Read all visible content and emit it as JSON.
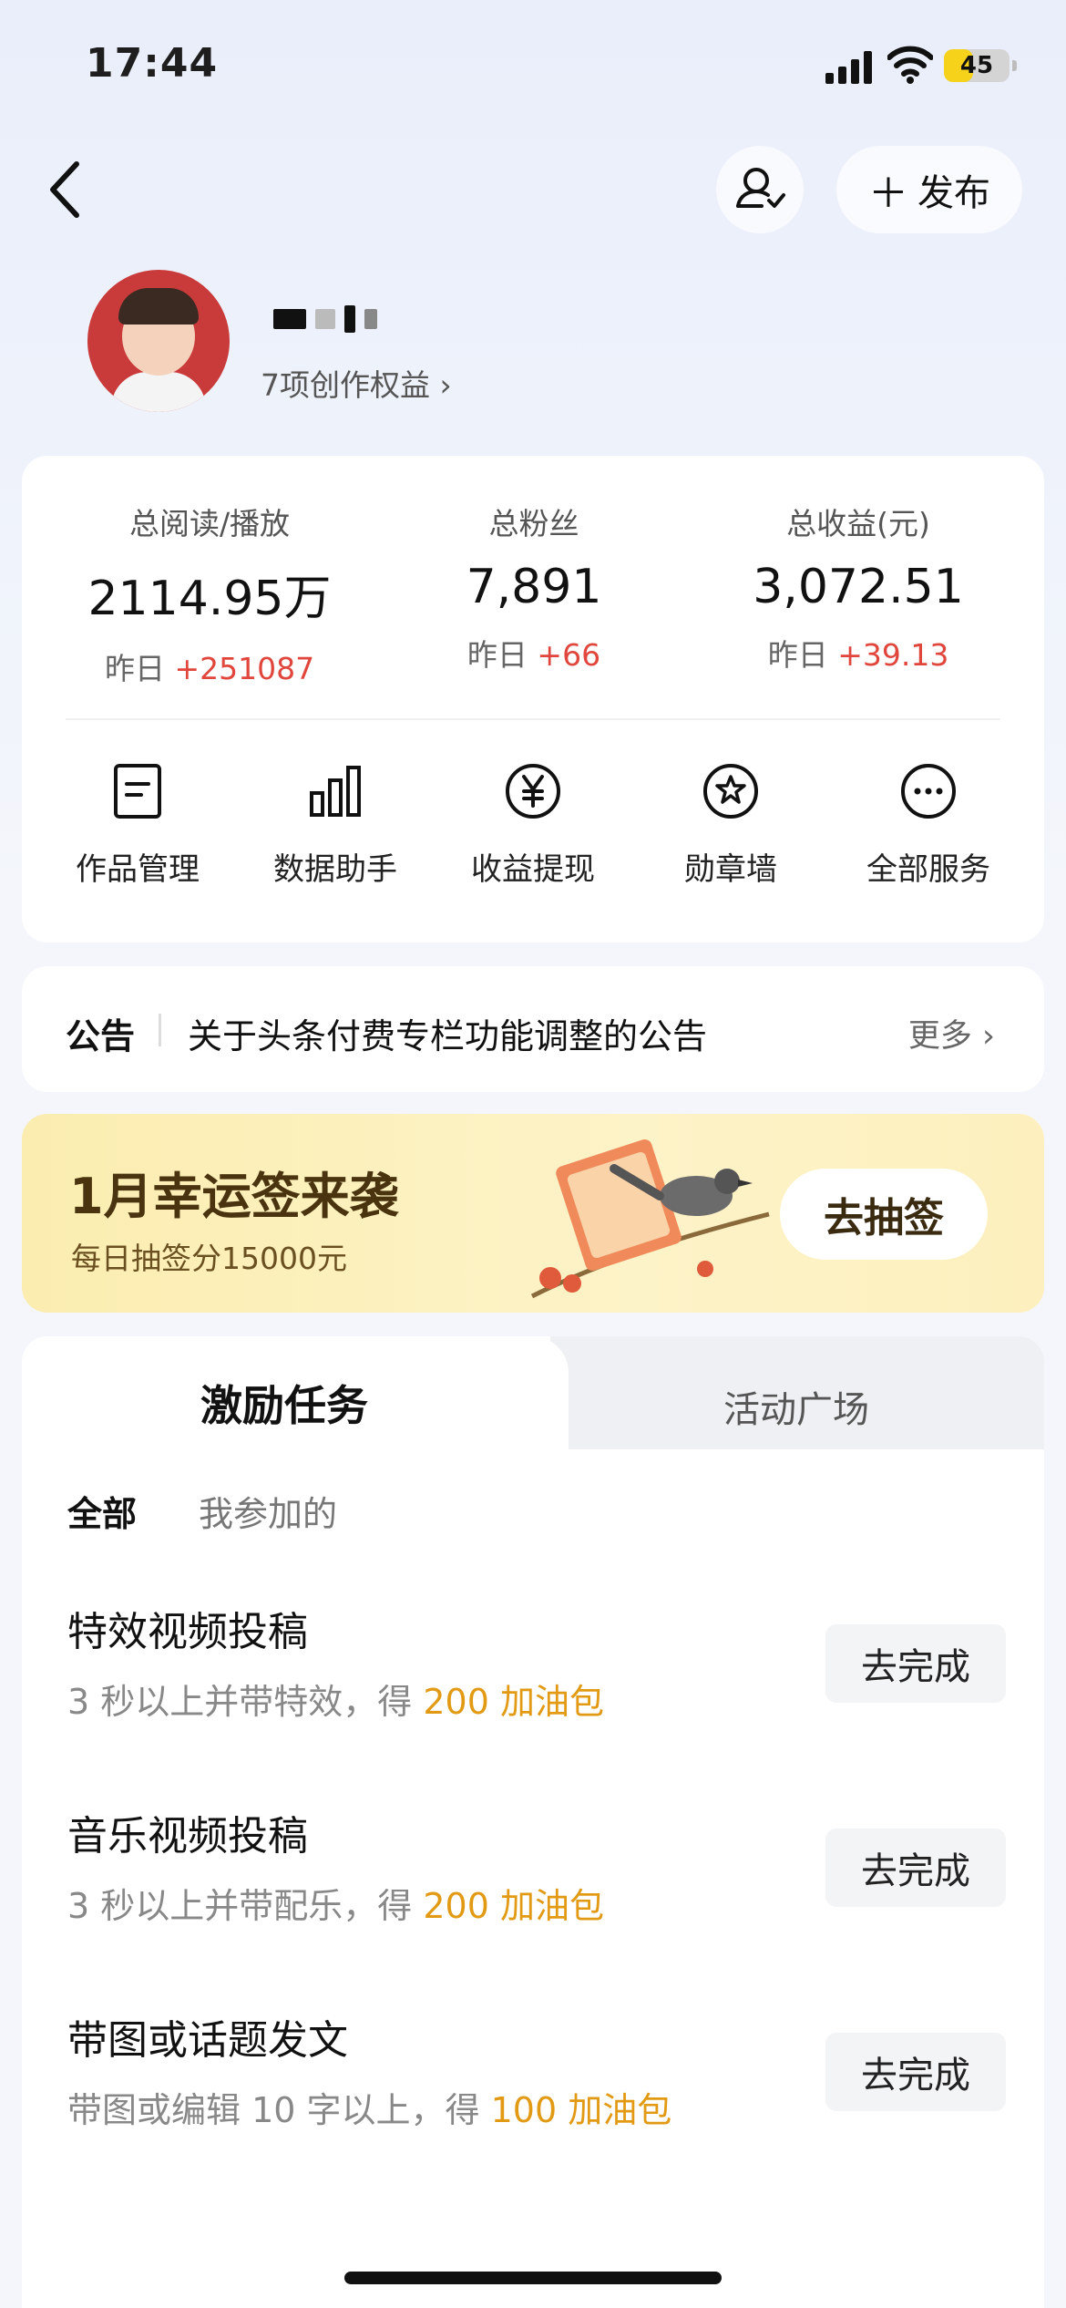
{
  "status_bar": {
    "time": "17:44",
    "battery": "45",
    "battery_level": 0.45
  },
  "header": {
    "publish_label": "发布",
    "icons": [
      "back-icon",
      "user-follow-icon",
      "plus-icon"
    ]
  },
  "profile": {
    "rights_label": "7项创作权益 ›"
  },
  "stats": [
    {
      "label": "总阅读/播放",
      "value": "2114.95万",
      "yday_prefix": "昨日 ",
      "yday_value": "+251087"
    },
    {
      "label": "总粉丝",
      "value": "7,891",
      "yday_prefix": "昨日 ",
      "yday_value": "+66"
    },
    {
      "label": "总收益(元)",
      "value": "3,072.51",
      "yday_prefix": "昨日 ",
      "yday_value": "+39.13"
    }
  ],
  "services": [
    {
      "label": "作品管理",
      "icon": "document-icon"
    },
    {
      "label": "数据助手",
      "icon": "bar-chart-icon"
    },
    {
      "label": "收益提现",
      "icon": "yen-icon"
    },
    {
      "label": "勋章墙",
      "icon": "badge-icon"
    },
    {
      "label": "全部服务",
      "icon": "more-icon"
    }
  ],
  "notice": {
    "tag": "公告",
    "text": "关于头条付费专栏功能调整的公告",
    "more": "更多 ›"
  },
  "banner": {
    "title": "1月幸运签来袭",
    "subtitle": "每日抽签分15000元",
    "button": "去抽签"
  },
  "tasks": {
    "tab_active": "激励任务",
    "tab_inactive": "活动广场",
    "filter_all": "全部",
    "filter_mine": "我参加的",
    "items": [
      {
        "title": "特效视频投稿",
        "desc": "3 秒以上并带特效，得 ",
        "reward": "200 加油包",
        "button": "去完成"
      },
      {
        "title": "音乐视频投稿",
        "desc": "3 秒以上并带配乐，得 ",
        "reward": "200 加油包",
        "button": "去完成"
      },
      {
        "title": "带图或话题发文",
        "desc": "带图或编辑 10 字以上，得 ",
        "reward": "100 加油包",
        "button": "去完成"
      }
    ]
  },
  "colors": {
    "accent_red": "#e0463c",
    "reward_orange": "#e29a14",
    "banner_yellow": "#fbedb0",
    "battery_yellow": "#f7d21b"
  }
}
